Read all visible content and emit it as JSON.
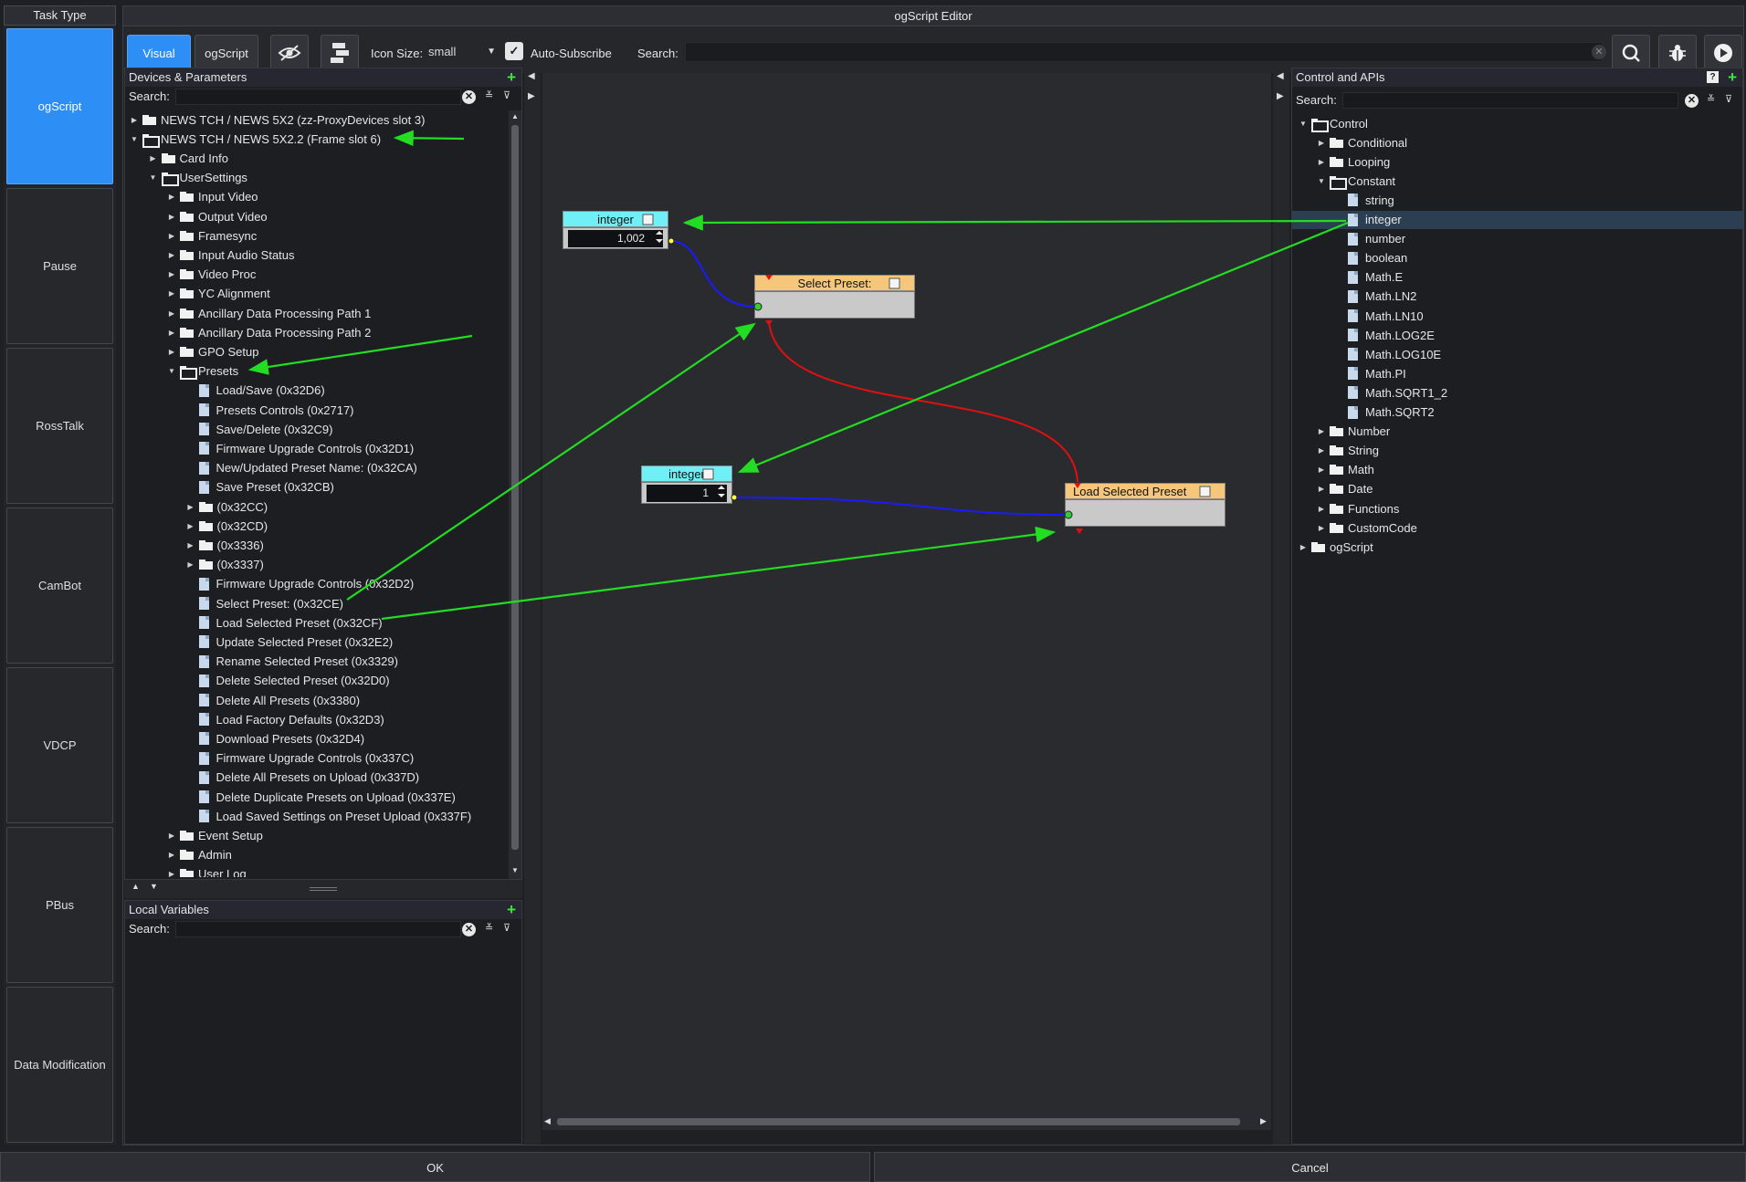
{
  "task_panel": {
    "title": "Task Type",
    "items": [
      "ogScript",
      "Pause",
      "RossTalk",
      "CamBot",
      "VDCP",
      "PBus",
      "Data Modification"
    ]
  },
  "editor": {
    "title": "ogScript Editor",
    "toolbar": {
      "visual_label": "Visual",
      "ogscript_label": "ogScript",
      "icon_size_label": "Icon Size:",
      "icon_size_value": "small",
      "auto_subscribe_label": "Auto-Subscribe",
      "auto_subscribe_checked": true,
      "search_label": "Search:",
      "search_value": ""
    }
  },
  "devices_panel": {
    "title": "Devices & Parameters",
    "search_label": "Search:",
    "tree": [
      {
        "d": 0,
        "t": "f",
        "o": false,
        "label": "NEWS TCH / NEWS 5X2 (zz-ProxyDevices slot 3)"
      },
      {
        "d": 0,
        "t": "f",
        "o": true,
        "label": "NEWS TCH / NEWS 5X2.2 (Frame slot 6)"
      },
      {
        "d": 1,
        "t": "f",
        "o": false,
        "label": "Card Info"
      },
      {
        "d": 1,
        "t": "f",
        "o": true,
        "label": "UserSettings"
      },
      {
        "d": 2,
        "t": "f",
        "o": false,
        "label": "Input Video"
      },
      {
        "d": 2,
        "t": "f",
        "o": false,
        "label": "Output Video"
      },
      {
        "d": 2,
        "t": "f",
        "o": false,
        "label": "Framesync"
      },
      {
        "d": 2,
        "t": "f",
        "o": false,
        "label": "Input Audio Status"
      },
      {
        "d": 2,
        "t": "f",
        "o": false,
        "label": "Video Proc"
      },
      {
        "d": 2,
        "t": "f",
        "o": false,
        "label": "YC Alignment"
      },
      {
        "d": 2,
        "t": "f",
        "o": false,
        "label": "Ancillary Data Processing Path 1"
      },
      {
        "d": 2,
        "t": "f",
        "o": false,
        "label": "Ancillary Data Processing Path 2"
      },
      {
        "d": 2,
        "t": "f",
        "o": false,
        "label": "GPO Setup"
      },
      {
        "d": 2,
        "t": "f",
        "o": true,
        "label": "Presets"
      },
      {
        "d": 3,
        "t": "d",
        "label": "Load/Save (0x32D6)"
      },
      {
        "d": 3,
        "t": "d",
        "label": "Presets Controls (0x2717)"
      },
      {
        "d": 3,
        "t": "d",
        "label": "Save/Delete (0x32C9)"
      },
      {
        "d": 3,
        "t": "d",
        "label": "Firmware Upgrade Controls (0x32D1)"
      },
      {
        "d": 3,
        "t": "d",
        "label": "New/Updated Preset Name: (0x32CA)"
      },
      {
        "d": 3,
        "t": "d",
        "label": "Save Preset (0x32CB)"
      },
      {
        "d": 3,
        "t": "f",
        "o": false,
        "label": "(0x32CC)"
      },
      {
        "d": 3,
        "t": "f",
        "o": false,
        "label": "(0x32CD)"
      },
      {
        "d": 3,
        "t": "f",
        "o": false,
        "label": "(0x3336)"
      },
      {
        "d": 3,
        "t": "f",
        "o": false,
        "label": "(0x3337)"
      },
      {
        "d": 3,
        "t": "d",
        "label": "Firmware Upgrade Controls (0x32D2)"
      },
      {
        "d": 3,
        "t": "d",
        "label": "Select Preset: (0x32CE)"
      },
      {
        "d": 3,
        "t": "d",
        "label": "Load Selected Preset (0x32CF)"
      },
      {
        "d": 3,
        "t": "d",
        "label": "Update Selected Preset (0x32E2)"
      },
      {
        "d": 3,
        "t": "d",
        "label": "Rename Selected Preset (0x3329)"
      },
      {
        "d": 3,
        "t": "d",
        "label": "Delete Selected Preset (0x32D0)"
      },
      {
        "d": 3,
        "t": "d",
        "label": "Delete All Presets (0x3380)"
      },
      {
        "d": 3,
        "t": "d",
        "label": "Load Factory Defaults (0x32D3)"
      },
      {
        "d": 3,
        "t": "d",
        "label": "Download Presets (0x32D4)"
      },
      {
        "d": 3,
        "t": "d",
        "label": "Firmware Upgrade Controls (0x337C)"
      },
      {
        "d": 3,
        "t": "d",
        "label": "Delete All Presets on Upload (0x337D)"
      },
      {
        "d": 3,
        "t": "d",
        "label": "Delete Duplicate Presets on Upload (0x337E)"
      },
      {
        "d": 3,
        "t": "d",
        "label": "Load Saved Settings on Preset Upload (0x337F)"
      },
      {
        "d": 2,
        "t": "f",
        "o": false,
        "label": "Event Setup"
      },
      {
        "d": 2,
        "t": "f",
        "o": false,
        "label": "Admin"
      },
      {
        "d": 2,
        "t": "f",
        "o": false,
        "label": "User Log"
      }
    ]
  },
  "local_vars_panel": {
    "title": "Local Variables",
    "search_label": "Search:"
  },
  "canvas": {
    "nodes": {
      "int1": {
        "title": "integer",
        "value": "1,002"
      },
      "select": {
        "title": "Select Preset:"
      },
      "int2": {
        "title": "integer",
        "value": "1"
      },
      "load": {
        "title": "Load Selected Preset"
      }
    }
  },
  "control_panel": {
    "title": "Control and APIs",
    "search_label": "Search:",
    "tree": [
      {
        "d": 0,
        "t": "f",
        "o": true,
        "label": "Control"
      },
      {
        "d": 1,
        "t": "f",
        "o": false,
        "label": "Conditional"
      },
      {
        "d": 1,
        "t": "f",
        "o": false,
        "label": "Looping"
      },
      {
        "d": 1,
        "t": "f",
        "o": true,
        "label": "Constant"
      },
      {
        "d": 2,
        "t": "d",
        "label": "string"
      },
      {
        "d": 2,
        "t": "d",
        "label": "integer",
        "sel": true
      },
      {
        "d": 2,
        "t": "d",
        "label": "number"
      },
      {
        "d": 2,
        "t": "d",
        "label": "boolean"
      },
      {
        "d": 2,
        "t": "d",
        "label": "Math.E"
      },
      {
        "d": 2,
        "t": "d",
        "label": "Math.LN2"
      },
      {
        "d": 2,
        "t": "d",
        "label": "Math.LN10"
      },
      {
        "d": 2,
        "t": "d",
        "label": "Math.LOG2E"
      },
      {
        "d": 2,
        "t": "d",
        "label": "Math.LOG10E"
      },
      {
        "d": 2,
        "t": "d",
        "label": "Math.PI"
      },
      {
        "d": 2,
        "t": "d",
        "label": "Math.SQRT1_2"
      },
      {
        "d": 2,
        "t": "d",
        "label": "Math.SQRT2"
      },
      {
        "d": 1,
        "t": "f",
        "o": false,
        "label": "Number"
      },
      {
        "d": 1,
        "t": "f",
        "o": false,
        "label": "String"
      },
      {
        "d": 1,
        "t": "f",
        "o": false,
        "label": "Math"
      },
      {
        "d": 1,
        "t": "f",
        "o": false,
        "label": "Date"
      },
      {
        "d": 1,
        "t": "f",
        "o": false,
        "label": "Functions"
      },
      {
        "d": 1,
        "t": "f",
        "o": false,
        "label": "CustomCode"
      },
      {
        "d": 0,
        "t": "f",
        "o": false,
        "label": "ogScript"
      }
    ]
  },
  "footer": {
    "ok_label": "OK",
    "cancel_label": "Cancel"
  },
  "colors": {
    "accent": "#2d8ef5",
    "annotation_arrow": "#22dd22",
    "wire_data": "#1a1aff",
    "wire_flow": "#e01010",
    "node_value": "#6ff0f6",
    "node_action": "#f6c77a"
  }
}
